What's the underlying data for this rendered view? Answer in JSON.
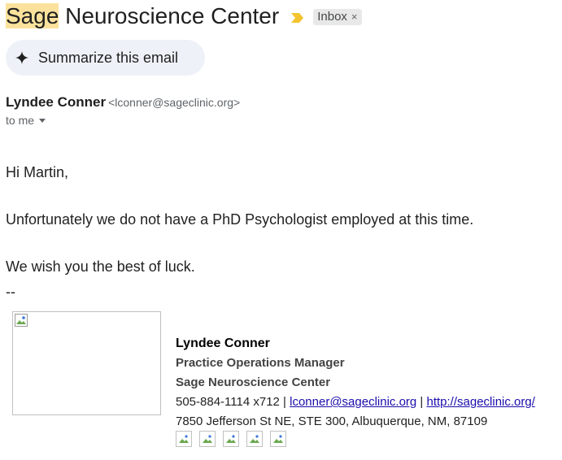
{
  "subject": {
    "highlight": "Sage",
    "rest": " Neuroscience Center",
    "label_chip": "Inbox",
    "label_remove": "×"
  },
  "summarize": {
    "label": "Summarize this email"
  },
  "sender": {
    "name": "Lyndee Conner",
    "email": "<lconner@sageclinic.org>",
    "to": "to me"
  },
  "body": {
    "greeting": "Hi Martin,",
    "line1": "Unfortunately we do not have a PhD Psychologist employed at this time.",
    "line2": "We wish you the best of luck.",
    "separator": "--"
  },
  "signature": {
    "name": "Lyndee Conner",
    "title": "Practice Operations Manager",
    "org": "Sage Neuroscience Center",
    "phone": "505-884-1114 x712 | ",
    "email_link": "lconner@sageclinic.org",
    "pipe": " | ",
    "web_link": "http://sageclinic.org/",
    "address": "7850 Jefferson St NE, STE 300, Albuquerque, NM, 87109"
  },
  "colors": {
    "highlight": "#fbe29c",
    "important_marker": "#f4c430",
    "link": "#1a0dab",
    "summarize_bg": "#eef2f8"
  }
}
